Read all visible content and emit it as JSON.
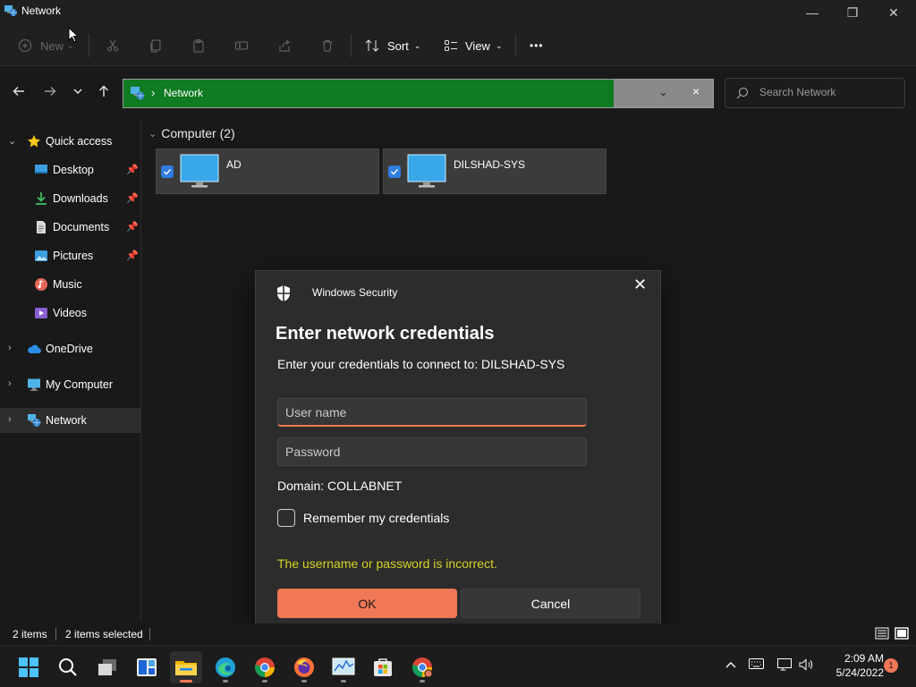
{
  "window": {
    "title": "Network",
    "minimize_glyph": "—",
    "maximize_glyph": "❐",
    "close_glyph": "✕"
  },
  "toolbar": {
    "new_label": "New",
    "sort_label": "Sort",
    "view_label": "View",
    "more_label": "•••"
  },
  "address": {
    "location": "Network",
    "search_placeholder": "Search Network"
  },
  "sidebar": {
    "items": [
      {
        "label": "Quick access",
        "icon": "star-icon",
        "pinned": false
      },
      {
        "label": "Desktop",
        "icon": "desktop-icon",
        "pinned": true
      },
      {
        "label": "Downloads",
        "icon": "download-icon",
        "pinned": true
      },
      {
        "label": "Documents",
        "icon": "document-icon",
        "pinned": true
      },
      {
        "label": "Pictures",
        "icon": "pictures-icon",
        "pinned": true
      },
      {
        "label": "Music",
        "icon": "music-icon",
        "pinned": false
      },
      {
        "label": "Videos",
        "icon": "videos-icon",
        "pinned": false
      },
      {
        "label": "OneDrive",
        "icon": "cloud-icon",
        "pinned": false
      },
      {
        "label": "My Computer",
        "icon": "computer-icon",
        "pinned": false
      },
      {
        "label": "Network",
        "icon": "network-icon",
        "pinned": false,
        "selected": true
      }
    ]
  },
  "content": {
    "group_label": "Computer (2)",
    "computers": [
      {
        "name": "AD",
        "selected": true
      },
      {
        "name": "DILSHAD-SYS",
        "selected": true
      }
    ]
  },
  "dialog": {
    "title": "Windows Security",
    "heading": "Enter network credentials",
    "subtitle": "Enter your credentials to connect to: DILSHAD-SYS",
    "username_placeholder": "User name",
    "username_value": "",
    "password_placeholder": "Password",
    "password_value": "",
    "domain": "Domain: COLLABNET",
    "remember_label": "Remember my credentials",
    "remember_checked": false,
    "error": "The username or password is incorrect.",
    "ok_label": "OK",
    "cancel_label": "Cancel"
  },
  "status": {
    "items_count": "2 items",
    "selected_count": "2 items selected"
  },
  "taskbar": {
    "time": "2:09 AM",
    "date": "5/24/2022",
    "notification_count": "1"
  },
  "colors": {
    "accent": "#f07856",
    "address_highlight": "#0f7b22",
    "error_text": "#d4d426",
    "checkbox_blue": "#2f7de1"
  }
}
